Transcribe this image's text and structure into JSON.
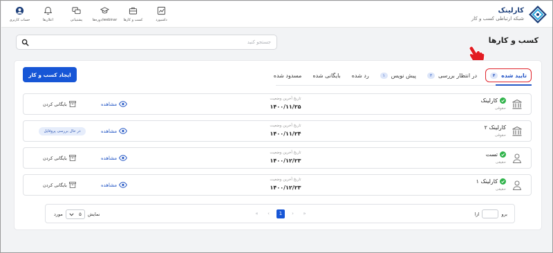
{
  "brand": {
    "name": "کارلینک",
    "tagline": "شبکه ارتباطی کسب و کار"
  },
  "nav": [
    {
      "icon": "profile-icon",
      "label": "حساب کاربری"
    },
    {
      "icon": "bell-icon",
      "label": "اعلان‌ها"
    },
    {
      "icon": "chat-icon",
      "label": "پشتیبانی"
    },
    {
      "icon": "webinar-icon",
      "label": "دوره‌ها/webinar"
    },
    {
      "icon": "briefcase-icon",
      "label": "کسب و کارها"
    },
    {
      "icon": "dashboard-icon",
      "label": "داشبورد"
    }
  ],
  "page": {
    "title": "کسب و کارها"
  },
  "search": {
    "placeholder": "جستجو کنید"
  },
  "create_button": "ایجاد کسب و کار",
  "tabs": [
    {
      "label": "تایید شده",
      "count": "۴",
      "active": true
    },
    {
      "label": "در انتظار بررسی",
      "count": "۳"
    },
    {
      "label": "پیش نویس",
      "count": "۱"
    },
    {
      "label": "رد شده",
      "count": ""
    },
    {
      "label": "بایگانی شده",
      "count": ""
    },
    {
      "label": "مسدود شده",
      "count": ""
    }
  ],
  "rows": [
    {
      "name": "کارلینک",
      "verified": true,
      "type": "حقوقی",
      "type_icon": "bank-icon",
      "date_label": "تاریخ آخرین وضعیت",
      "date": "۱۴۰۰/۱۱/۲۵",
      "view": "مشاهده",
      "action": "بایگانی کردن"
    },
    {
      "name": "کارلینک ۲",
      "verified": false,
      "type": "حقوقی",
      "type_icon": "bank-icon",
      "date_label": "تاریخ آخرین وضعیت",
      "date": "۱۴۰۰/۱۱/۲۴",
      "view": "مشاهده",
      "status": "در حال بررسی پروفایل"
    },
    {
      "name": "تست",
      "verified": true,
      "type": "حقیقی",
      "type_icon": "person-icon",
      "date_label": "تاریخ آخرین وضعیت",
      "date": "۱۴۰۰/۱۲/۲۳",
      "view": "مشاهده",
      "action": "بایگانی کردن"
    },
    {
      "name": "کارلینک ۱",
      "verified": true,
      "type": "حقیقی",
      "type_icon": "person-icon",
      "date_label": "تاریخ آخرین وضعیت",
      "date": "۱۴۰۰/۱۲/۲۳",
      "view": "مشاهده",
      "action": "بایگانی کردن"
    }
  ],
  "pagination": {
    "go_label": "برو",
    "go_suffix": "ازا",
    "current_page": "1",
    "show_label": "نمایش",
    "page_size": "۵",
    "unit_label": "مورد"
  },
  "colors": {
    "primary": "#1756d6",
    "highlight": "#e0232b",
    "verified": "#2fb34a"
  }
}
